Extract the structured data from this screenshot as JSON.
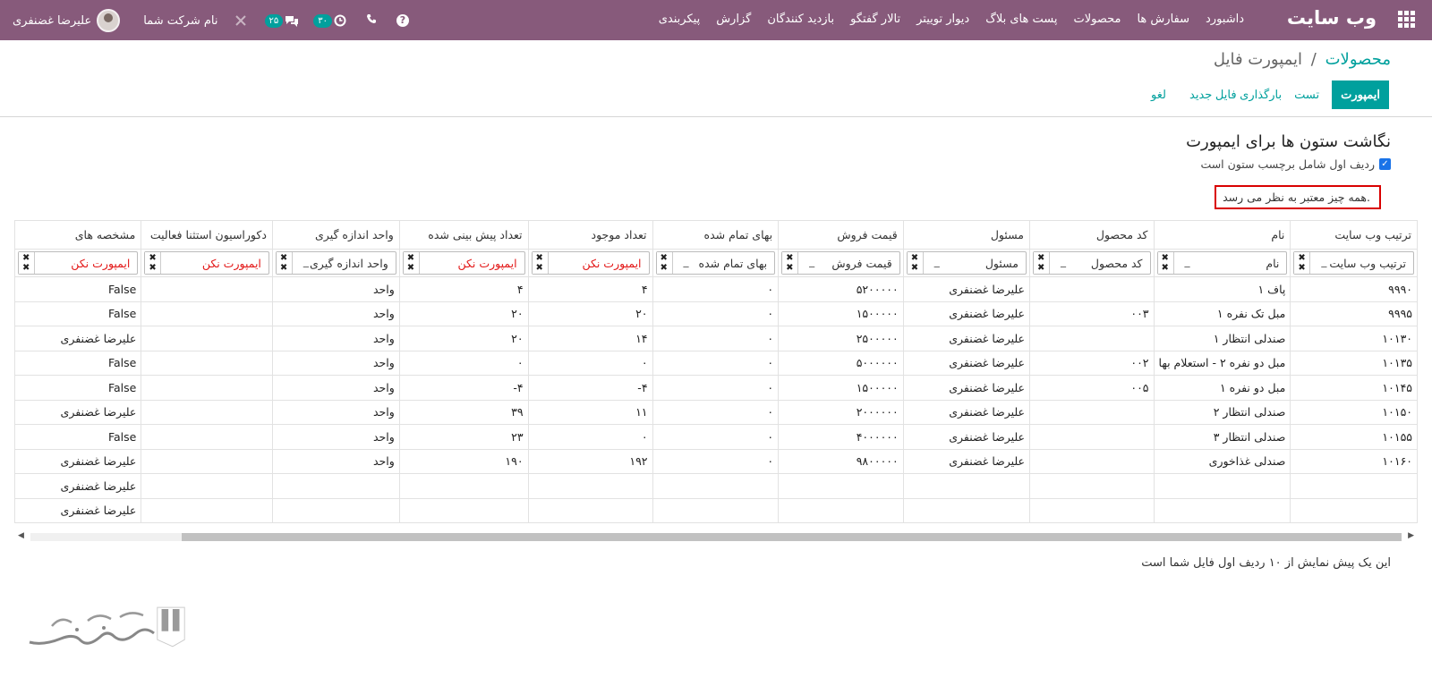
{
  "navbar": {
    "brand": "وب سایت",
    "menu": [
      "داشبورد",
      "سفارش ها",
      "محصولات",
      "پست های بلاگ",
      "دیوار توییتر",
      "تالار گفتگو",
      "بازدید کنندگان",
      "گزارش",
      "پیکربندی"
    ],
    "company": "نام شرکت شما",
    "user": "علیرضا غضنفری",
    "badge_messages": "۲۵",
    "badge_activities": "۳۰"
  },
  "breadcrumb": {
    "parent": "محصولات",
    "separator": "/",
    "current": "ایمپورت فایل"
  },
  "toolbar": {
    "import": "ایمپورت",
    "test": "تست",
    "reload": "بارگذاری فایل جدید",
    "cancel": "لغو"
  },
  "mapping": {
    "title": "نگاشت ستون ها برای ایمپورت",
    "header_checkbox_label": "ردیف اول شامل برچسب ستون است",
    "valid_message": "همه چیز معتبر به نظر می رسد.",
    "preview_note": "این یک پیش نمایش از ۱۰ ردیف اول فایل شما است"
  },
  "table": {
    "headers": [
      "ترتیب وب سایت",
      "نام",
      "کد محصول",
      "مسئول",
      "قیمت فروش",
      "بهای تمام شده",
      "تعداد موجود",
      "تعداد پیش بینی شده",
      "واحد اندازه گیری",
      "دکوراسیون استثنا فعالیت",
      "مشخصه های"
    ],
    "selectors": [
      {
        "text": "ترتیب وب سایت",
        "dont_import": false
      },
      {
        "text": "نام",
        "dont_import": false
      },
      {
        "text": "کد محصول",
        "dont_import": false
      },
      {
        "text": "مسئول",
        "dont_import": false
      },
      {
        "text": "قیمت فروش",
        "dont_import": false
      },
      {
        "text": "بهای تمام شده",
        "dont_import": false
      },
      {
        "text": "ایمپورت نکن",
        "dont_import": true
      },
      {
        "text": "ایمپورت نکن",
        "dont_import": true
      },
      {
        "text": "واحد اندازه گیری",
        "dont_import": false
      },
      {
        "text": "ایمپورت نکن",
        "dont_import": true
      },
      {
        "text": "ایمپورت نکن",
        "dont_import": true
      }
    ],
    "dash": "_",
    "rows": [
      [
        "۹۹۹۰",
        "پاف ۱",
        "",
        "علیرضا غضنفری",
        "۵۲۰۰۰۰۰",
        "۰",
        "۴",
        "۴",
        "واحد",
        "",
        "False"
      ],
      [
        "۹۹۹۵",
        "مبل تک نفره ۱",
        "۰۰۳",
        "علیرضا غضنفری",
        "۱۵۰۰۰۰۰",
        "۰",
        "۲۰",
        "۲۰",
        "واحد",
        "",
        "False"
      ],
      [
        "۱۰۱۳۰",
        "صندلی انتظار ۱",
        "",
        "علیرضا غضنفری",
        "۲۵۰۰۰۰۰",
        "۰",
        "۱۴",
        "۲۰",
        "واحد",
        "",
        "علیرضا غضنفری"
      ],
      [
        "۱۰۱۳۵",
        "مبل دو نفره ۲ - استعلام بها",
        "۰۰۲",
        "علیرضا غضنفری",
        "۵۰۰۰۰۰۰",
        "۰",
        "۰",
        "۰",
        "واحد",
        "",
        "False"
      ],
      [
        "۱۰۱۴۵",
        "مبل دو نفره ۱",
        "۰۰۵",
        "علیرضا غضنفری",
        "۱۵۰۰۰۰۰",
        "۰",
        "۴-",
        "۴-",
        "واحد",
        "",
        "False"
      ],
      [
        "۱۰۱۵۰",
        "صندلی انتظار ۲",
        "",
        "علیرضا غضنفری",
        "۲۰۰۰۰۰۰",
        "۰",
        "۱۱",
        "۳۹",
        "واحد",
        "",
        "علیرضا غضنفری"
      ],
      [
        "۱۰۱۵۵",
        "صندلی انتظار ۳",
        "",
        "علیرضا غضنفری",
        "۴۰۰۰۰۰۰",
        "۰",
        "۰",
        "۲۳",
        "واحد",
        "",
        "False"
      ],
      [
        "۱۰۱۶۰",
        "صندلی غذاخوری",
        "",
        "علیرضا غضنفری",
        "۹۸۰۰۰۰۰",
        "۰",
        "۱۹۲",
        "۱۹۰",
        "واحد",
        "",
        "علیرضا غضنفری"
      ],
      [
        "",
        "",
        "",
        "",
        "",
        "",
        "",
        "",
        "",
        "",
        "علیرضا غضنفری"
      ],
      [
        "",
        "",
        "",
        "",
        "",
        "",
        "",
        "",
        "",
        "",
        "علیرضا غضنفری"
      ]
    ]
  },
  "colors": {
    "navbar": "#875a7b",
    "primary": "#00a09d",
    "error_text": "#e31919",
    "valid_border": "#d90000"
  },
  "icons": [
    "apps-grid-icon",
    "help-icon",
    "phone-icon",
    "activity-clock-icon",
    "chat-icon",
    "close-icon",
    "checkbox-checked-icon",
    "remove-x-icon",
    "scroll-left-icon",
    "scroll-right-icon"
  ]
}
